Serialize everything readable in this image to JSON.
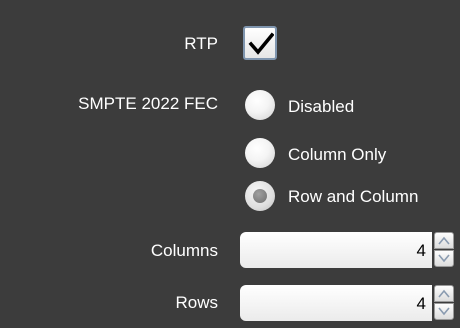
{
  "rtp": {
    "label": "RTP",
    "checked": true
  },
  "fec": {
    "label": "SMPTE 2022 FEC",
    "options": [
      {
        "label": "Disabled",
        "selected": false
      },
      {
        "label": "Column Only",
        "selected": false
      },
      {
        "label": "Row and Column",
        "selected": true
      }
    ]
  },
  "columns": {
    "label": "Columns",
    "value": "4"
  },
  "rows": {
    "label": "Rows",
    "value": "4"
  },
  "icons": {
    "check": "checkmark-icon",
    "up": "chevron-up-icon",
    "down": "chevron-down-icon"
  },
  "colors": {
    "panel": "#3c3c3c",
    "text": "#ffffff"
  }
}
